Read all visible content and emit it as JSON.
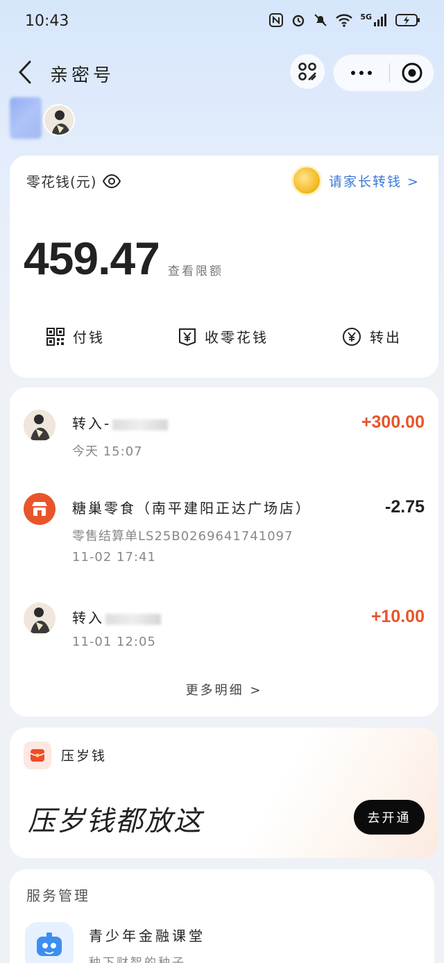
{
  "status_bar": {
    "time": "10:43",
    "network": "5G"
  },
  "nav": {
    "title": "亲密号"
  },
  "balance": {
    "label": "零花钱(元)",
    "amount": "459.47",
    "limit_link": "查看限额",
    "parent_tab": "请家长转钱 >"
  },
  "actions": [
    {
      "label": "付钱",
      "icon": "qr-code-icon"
    },
    {
      "label": "收零花钱",
      "icon": "receive-yen-icon"
    },
    {
      "label": "转出",
      "icon": "yen-circle-icon"
    }
  ],
  "transactions": [
    {
      "title": "转入-",
      "amount": "+300.00",
      "time": "今天 15:07",
      "kind": "income"
    },
    {
      "title": "糖巢零食（南平建阳正达广场店）",
      "amount": "-2.75",
      "ref": "零售结算单LS25B0269641741097",
      "time": "11-02 17:41",
      "kind": "expense"
    },
    {
      "title": "转入",
      "amount": "+10.00",
      "time": "11-01 12:05",
      "kind": "income"
    }
  ],
  "more_detail": "更多明细 >",
  "red_packet": {
    "title": "压岁钱",
    "slogan": "压岁钱都放这",
    "button": "去开通"
  },
  "service": {
    "section_title": "服务管理",
    "item_name": "青少年金融课堂",
    "item_sub": "种下财智的种子"
  },
  "colors": {
    "income": "#e8552a",
    "expense": "#222222",
    "accent_blue": "#3a78d8"
  }
}
